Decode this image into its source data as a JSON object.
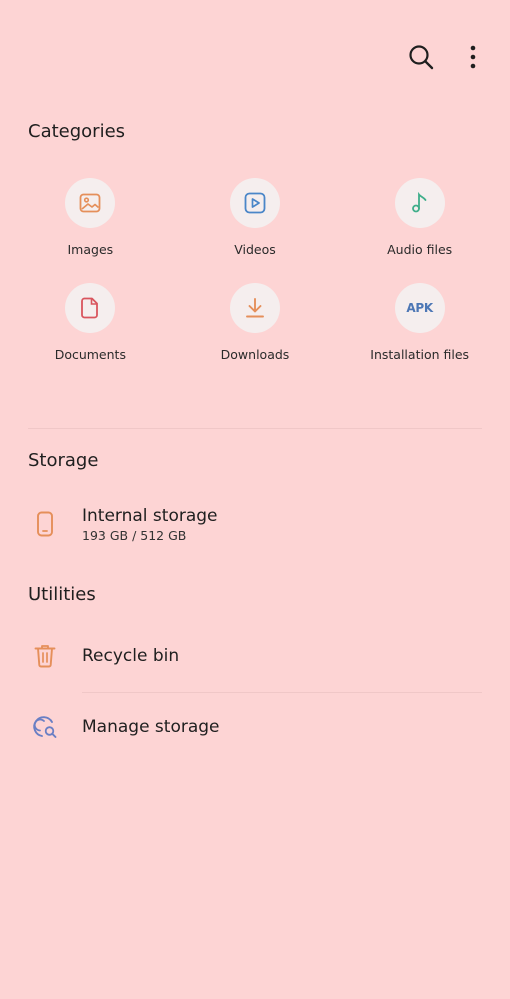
{
  "categories": {
    "title": "Categories",
    "items": [
      {
        "label": "Images",
        "icon": "image-icon",
        "color": "#e58f5a"
      },
      {
        "label": "Videos",
        "icon": "video-icon",
        "color": "#4a86c8"
      },
      {
        "label": "Audio files",
        "icon": "music-note-icon",
        "color": "#3fae8a"
      },
      {
        "label": "Documents",
        "icon": "document-icon",
        "color": "#d9555e"
      },
      {
        "label": "Downloads",
        "icon": "download-icon",
        "color": "#e58f5a"
      },
      {
        "label": "Installation files",
        "icon": "apk-icon",
        "icon_text": "APK",
        "color": "#4d77b5"
      }
    ]
  },
  "storage": {
    "title": "Storage",
    "internal": {
      "title": "Internal storage",
      "usage": "193 GB / 512 GB",
      "icon": "phone-icon"
    }
  },
  "utilities": {
    "title": "Utilities",
    "items": [
      {
        "label": "Recycle bin",
        "icon": "trash-icon"
      },
      {
        "label": "Manage storage",
        "icon": "manage-storage-icon"
      }
    ]
  },
  "toolbar": {
    "icons": [
      "search-icon",
      "more-options-icon"
    ]
  },
  "colors": {
    "background": "#fdd4d4",
    "accent_orange": "#e58f5a",
    "accent_blue": "#4a86c8"
  }
}
